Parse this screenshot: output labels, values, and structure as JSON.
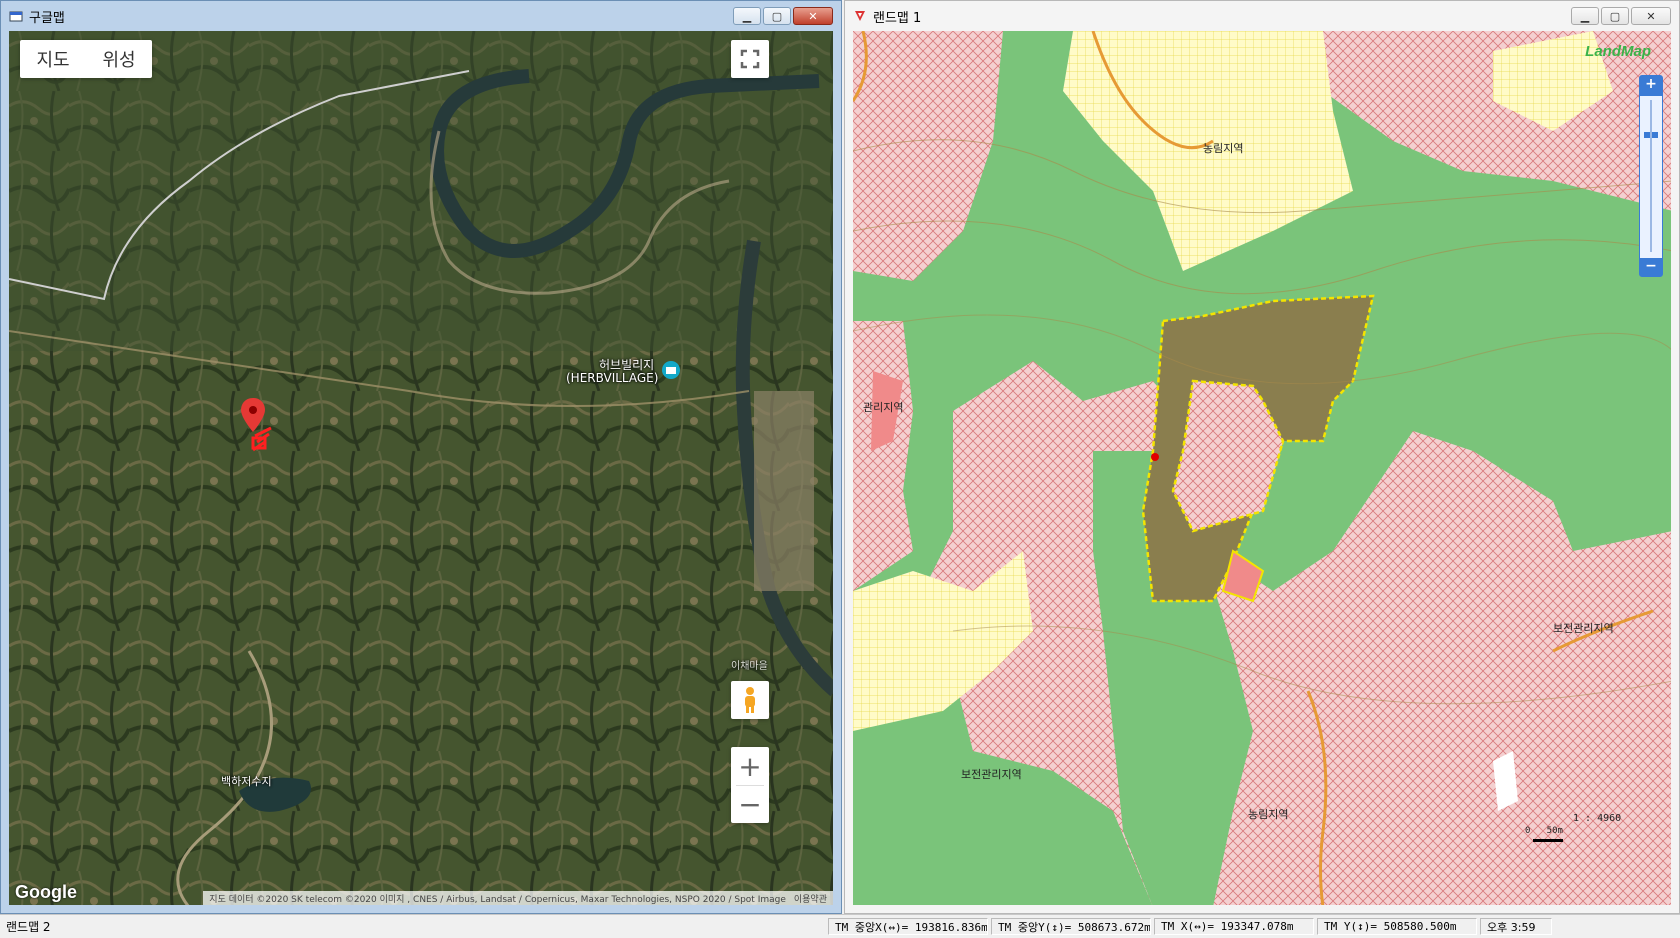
{
  "left_window": {
    "title": "구글맵",
    "buttons": {
      "minimize": "▁",
      "maximize": "▢",
      "close": "✕"
    },
    "map_type": {
      "map": "지도",
      "satellite": "위성"
    },
    "labels": {
      "place_name": "허브빌리지",
      "place_name_en": "(HERBVILLAGE)",
      "reservoir": "백하저수지",
      "village": "이채마을"
    },
    "zoom": {
      "in": "+",
      "out": "−"
    },
    "logo": "Google",
    "attribution": "지도 데이터 ©2020 SK telecom ©2020 이미지 , CNES / Airbus, Landsat / Copernicus, Maxar Technologies, NSPO 2020 / Spot Image",
    "terms": "이용약관"
  },
  "right_window": {
    "title": "랜드맵 1",
    "buttons": {
      "minimize": "▁",
      "maximize": "▢",
      "close": "✕"
    },
    "logo": "LandMap",
    "zoom": {
      "in": "+",
      "out": "−"
    },
    "zones": {
      "agri_top": "농림지역",
      "mgmt": "관리지역",
      "conserv_right": "보전관리지역",
      "conserv_bottom": "보전관리지역",
      "agri_bottom": "농림지역"
    },
    "scale": {
      "ratio": "1 : 4960",
      "bar": "0   50m"
    }
  },
  "statusbar": {
    "app": "랜드맵 2",
    "tm_center_x": "TM 중앙X(↔)= 193816.836m",
    "tm_center_y": "TM 중앙Y(↕)= 508673.672m",
    "tm_x": "TM X(↔)= 193347.078m",
    "tm_y": "TM Y(↕)= 508580.500m",
    "clock": "오후 3:59"
  },
  "colors": {
    "green_zone": "#7ac47a",
    "pink_zone": "#f3c6c6",
    "yellow_zone": "#fffbc2",
    "parcel": "#8a7e4e",
    "parcel_border": "#f4e400"
  }
}
